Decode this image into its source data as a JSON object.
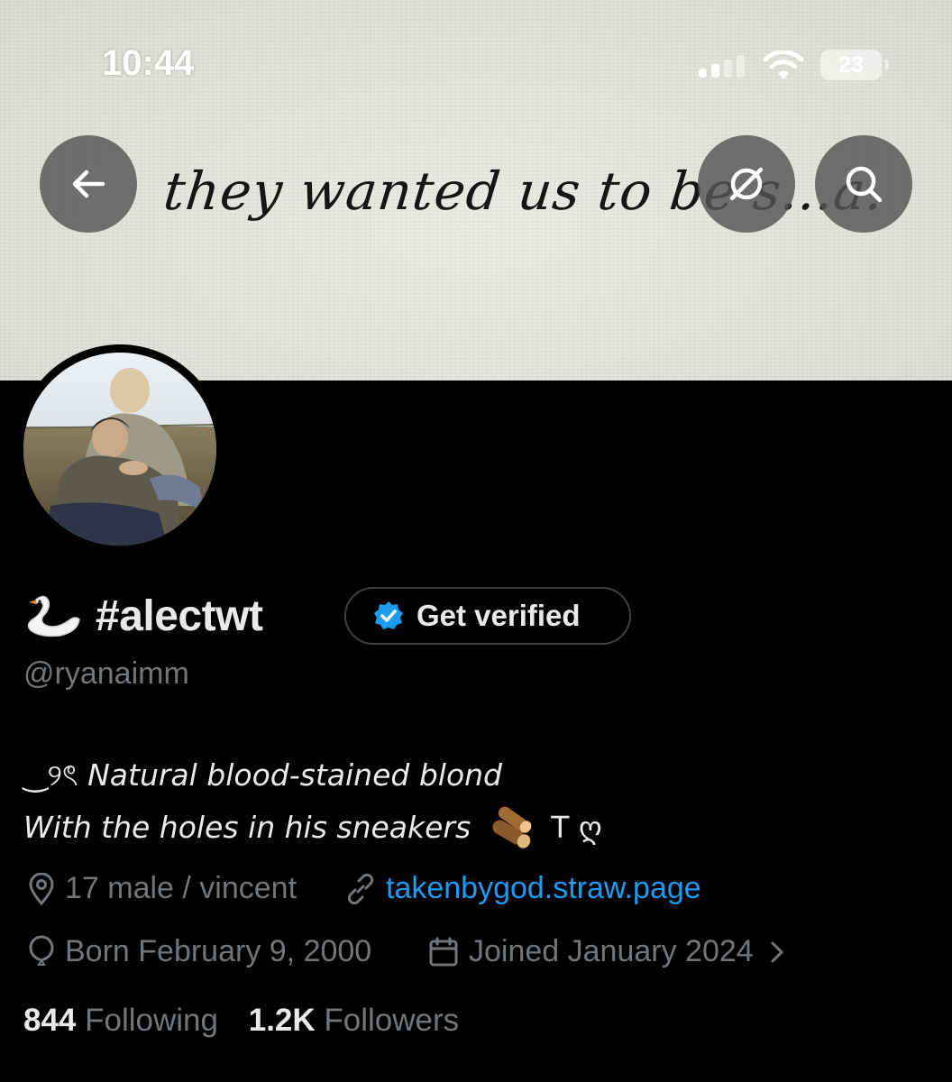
{
  "status_bar": {
    "time": "10:44",
    "battery": "23"
  },
  "header": {
    "banner_text": "they wanted us to be s...a."
  },
  "icons": {
    "back": "arrow-left-icon",
    "grok": "grok-icon",
    "search": "search-icon",
    "verified": "verified-badge-icon",
    "location": "location-pin-icon",
    "link": "link-icon",
    "birthday": "balloon-icon",
    "calendar": "calendar-icon",
    "swan": "swan-emoji-icon",
    "wood": "wood-emoji-icon"
  },
  "profile": {
    "display_name": "#alectwt",
    "get_verified_label": "Get verified",
    "handle": "@ryanaimm",
    "bio_line1_prefix": "‿୨ৎ",
    "bio_line1": "Natural blood-stained blond",
    "bio_line2": "With the holes in his sneakers",
    "bio_line2_suffix": "T ღ",
    "location": "17 male / vincent",
    "website": "takenbygod.straw.page",
    "birthday": "Born February 9, 2000",
    "joined": "Joined January 2024",
    "following_count": "844",
    "following_label": "Following",
    "followers_count": "1.2K",
    "followers_label": "Followers"
  },
  "colors": {
    "background": "#000000",
    "primary_text": "#e7e9ea",
    "secondary_text": "#71767b",
    "link": "#1d9bf0",
    "verified_badge": "#1d9bf0"
  }
}
